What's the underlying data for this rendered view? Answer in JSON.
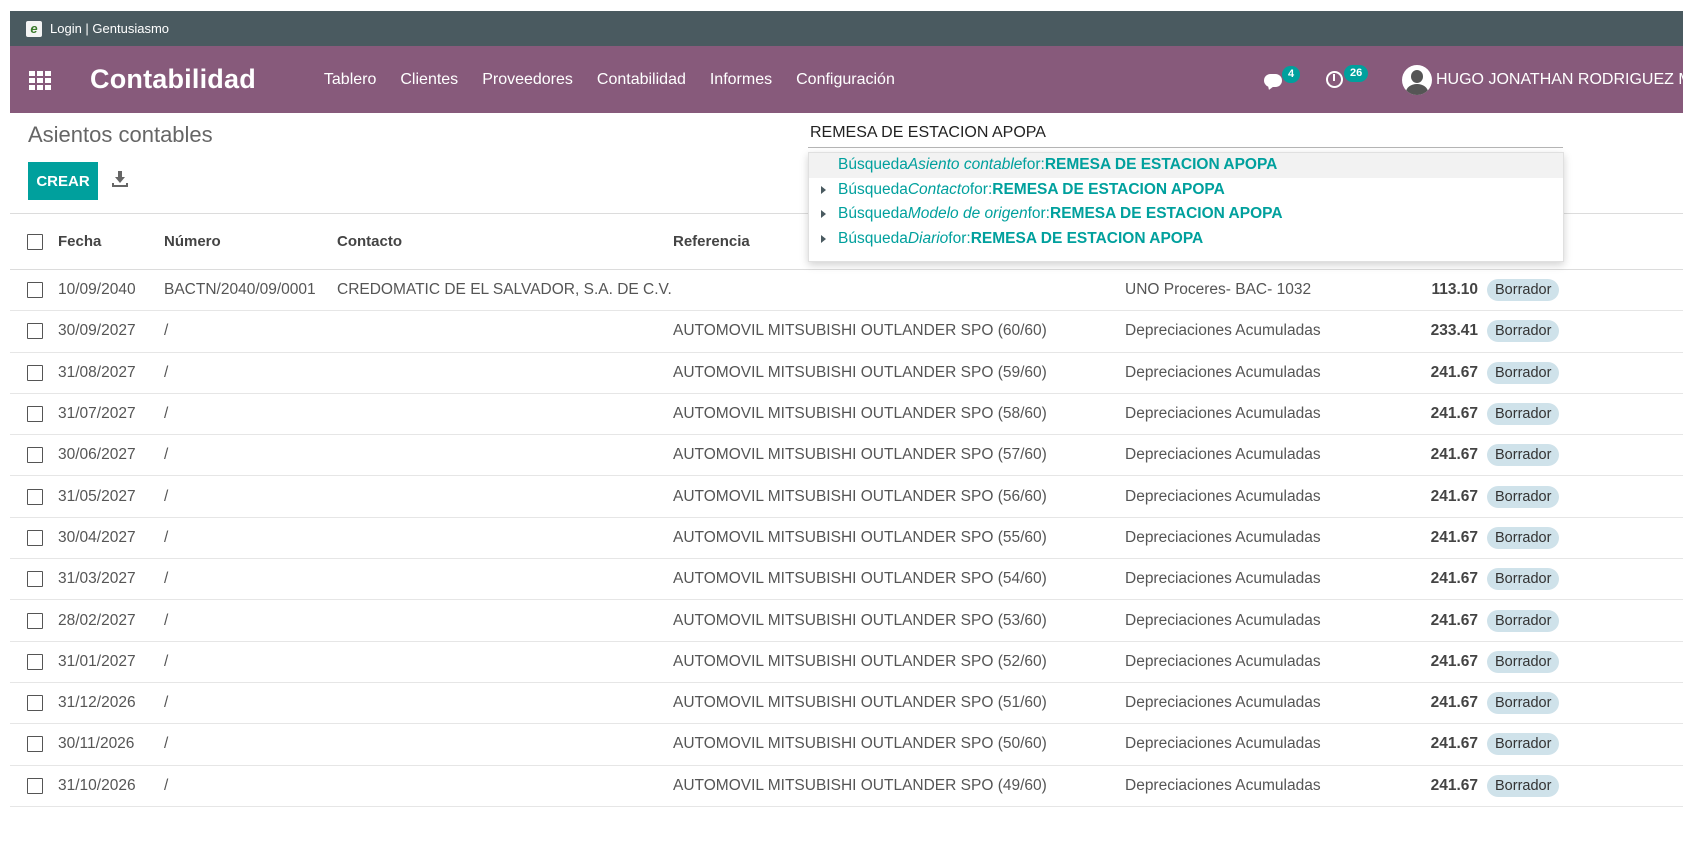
{
  "titlebar": {
    "title": "Login | Gentusiasmo",
    "icon": "e"
  },
  "navbar": {
    "brand": "Contabilidad",
    "menu": [
      "Tablero",
      "Clientes",
      "Proveedores",
      "Contabilidad",
      "Informes",
      "Configuración"
    ],
    "messages_count": "4",
    "activities_count": "26",
    "user_name": "HUGO JONATHAN RODRIGUEZ MOJICA",
    "accent_color": "#875a7b",
    "badge_color": "#00a09d"
  },
  "page": {
    "title": "Asientos contables",
    "create_label": "CREAR"
  },
  "search": {
    "value": "REMESA DE ESTACION APOPA",
    "suggestions": [
      {
        "prefix": "Búsqueda ",
        "field": "Asiento contable",
        "mid": " for: ",
        "term": "REMESA DE ESTACION APOPA"
      },
      {
        "prefix": "Búsqueda ",
        "field": "Contacto",
        "mid": " for: ",
        "term": "REMESA DE ESTACION APOPA"
      },
      {
        "prefix": "Búsqueda ",
        "field": "Modelo de origen",
        "mid": " for: ",
        "term": "REMESA DE ESTACION APOPA"
      },
      {
        "prefix": "Búsqueda ",
        "field": "Diario",
        "mid": " for: ",
        "term": "REMESA DE ESTACION APOPA"
      }
    ]
  },
  "table": {
    "headers": {
      "fecha": "Fecha",
      "numero": "Número",
      "contacto": "Contacto",
      "referencia": "Referencia"
    },
    "rows": [
      {
        "fecha": "10/09/2040",
        "numero": "BACTN/2040/09/0001",
        "contacto": "CREDOMATIC DE EL SALVADOR, S.A. DE C.V.",
        "referencia": "",
        "diario": "UNO Proceres- BAC- 1032",
        "total": "113.10",
        "estado": "Borrador"
      },
      {
        "fecha": "30/09/2027",
        "numero": "/",
        "contacto": "",
        "referencia": "AUTOMOVIL MITSUBISHI OUTLANDER SPO (60/60)",
        "diario": "Depreciaciones Acumuladas",
        "total": "233.41",
        "estado": "Borrador"
      },
      {
        "fecha": "31/08/2027",
        "numero": "/",
        "contacto": "",
        "referencia": "AUTOMOVIL MITSUBISHI OUTLANDER SPO (59/60)",
        "diario": "Depreciaciones Acumuladas",
        "total": "241.67",
        "estado": "Borrador"
      },
      {
        "fecha": "31/07/2027",
        "numero": "/",
        "contacto": "",
        "referencia": "AUTOMOVIL MITSUBISHI OUTLANDER SPO (58/60)",
        "diario": "Depreciaciones Acumuladas",
        "total": "241.67",
        "estado": "Borrador"
      },
      {
        "fecha": "30/06/2027",
        "numero": "/",
        "contacto": "",
        "referencia": "AUTOMOVIL MITSUBISHI OUTLANDER SPO (57/60)",
        "diario": "Depreciaciones Acumuladas",
        "total": "241.67",
        "estado": "Borrador"
      },
      {
        "fecha": "31/05/2027",
        "numero": "/",
        "contacto": "",
        "referencia": "AUTOMOVIL MITSUBISHI OUTLANDER SPO (56/60)",
        "diario": "Depreciaciones Acumuladas",
        "total": "241.67",
        "estado": "Borrador"
      },
      {
        "fecha": "30/04/2027",
        "numero": "/",
        "contacto": "",
        "referencia": "AUTOMOVIL MITSUBISHI OUTLANDER SPO (55/60)",
        "diario": "Depreciaciones Acumuladas",
        "total": "241.67",
        "estado": "Borrador"
      },
      {
        "fecha": "31/03/2027",
        "numero": "/",
        "contacto": "",
        "referencia": "AUTOMOVIL MITSUBISHI OUTLANDER SPO (54/60)",
        "diario": "Depreciaciones Acumuladas",
        "total": "241.67",
        "estado": "Borrador"
      },
      {
        "fecha": "28/02/2027",
        "numero": "/",
        "contacto": "",
        "referencia": "AUTOMOVIL MITSUBISHI OUTLANDER SPO (53/60)",
        "diario": "Depreciaciones Acumuladas",
        "total": "241.67",
        "estado": "Borrador"
      },
      {
        "fecha": "31/01/2027",
        "numero": "/",
        "contacto": "",
        "referencia": "AUTOMOVIL MITSUBISHI OUTLANDER SPO (52/60)",
        "diario": "Depreciaciones Acumuladas",
        "total": "241.67",
        "estado": "Borrador"
      },
      {
        "fecha": "31/12/2026",
        "numero": "/",
        "contacto": "",
        "referencia": "AUTOMOVIL MITSUBISHI OUTLANDER SPO (51/60)",
        "diario": "Depreciaciones Acumuladas",
        "total": "241.67",
        "estado": "Borrador"
      },
      {
        "fecha": "30/11/2026",
        "numero": "/",
        "contacto": "",
        "referencia": "AUTOMOVIL MITSUBISHI OUTLANDER SPO (50/60)",
        "diario": "Depreciaciones Acumuladas",
        "total": "241.67",
        "estado": "Borrador"
      },
      {
        "fecha": "31/10/2026",
        "numero": "/",
        "contacto": "",
        "referencia": "AUTOMOVIL MITSUBISHI OUTLANDER SPO (49/60)",
        "diario": "Depreciaciones Acumuladas",
        "total": "241.67",
        "estado": "Borrador"
      }
    ]
  }
}
